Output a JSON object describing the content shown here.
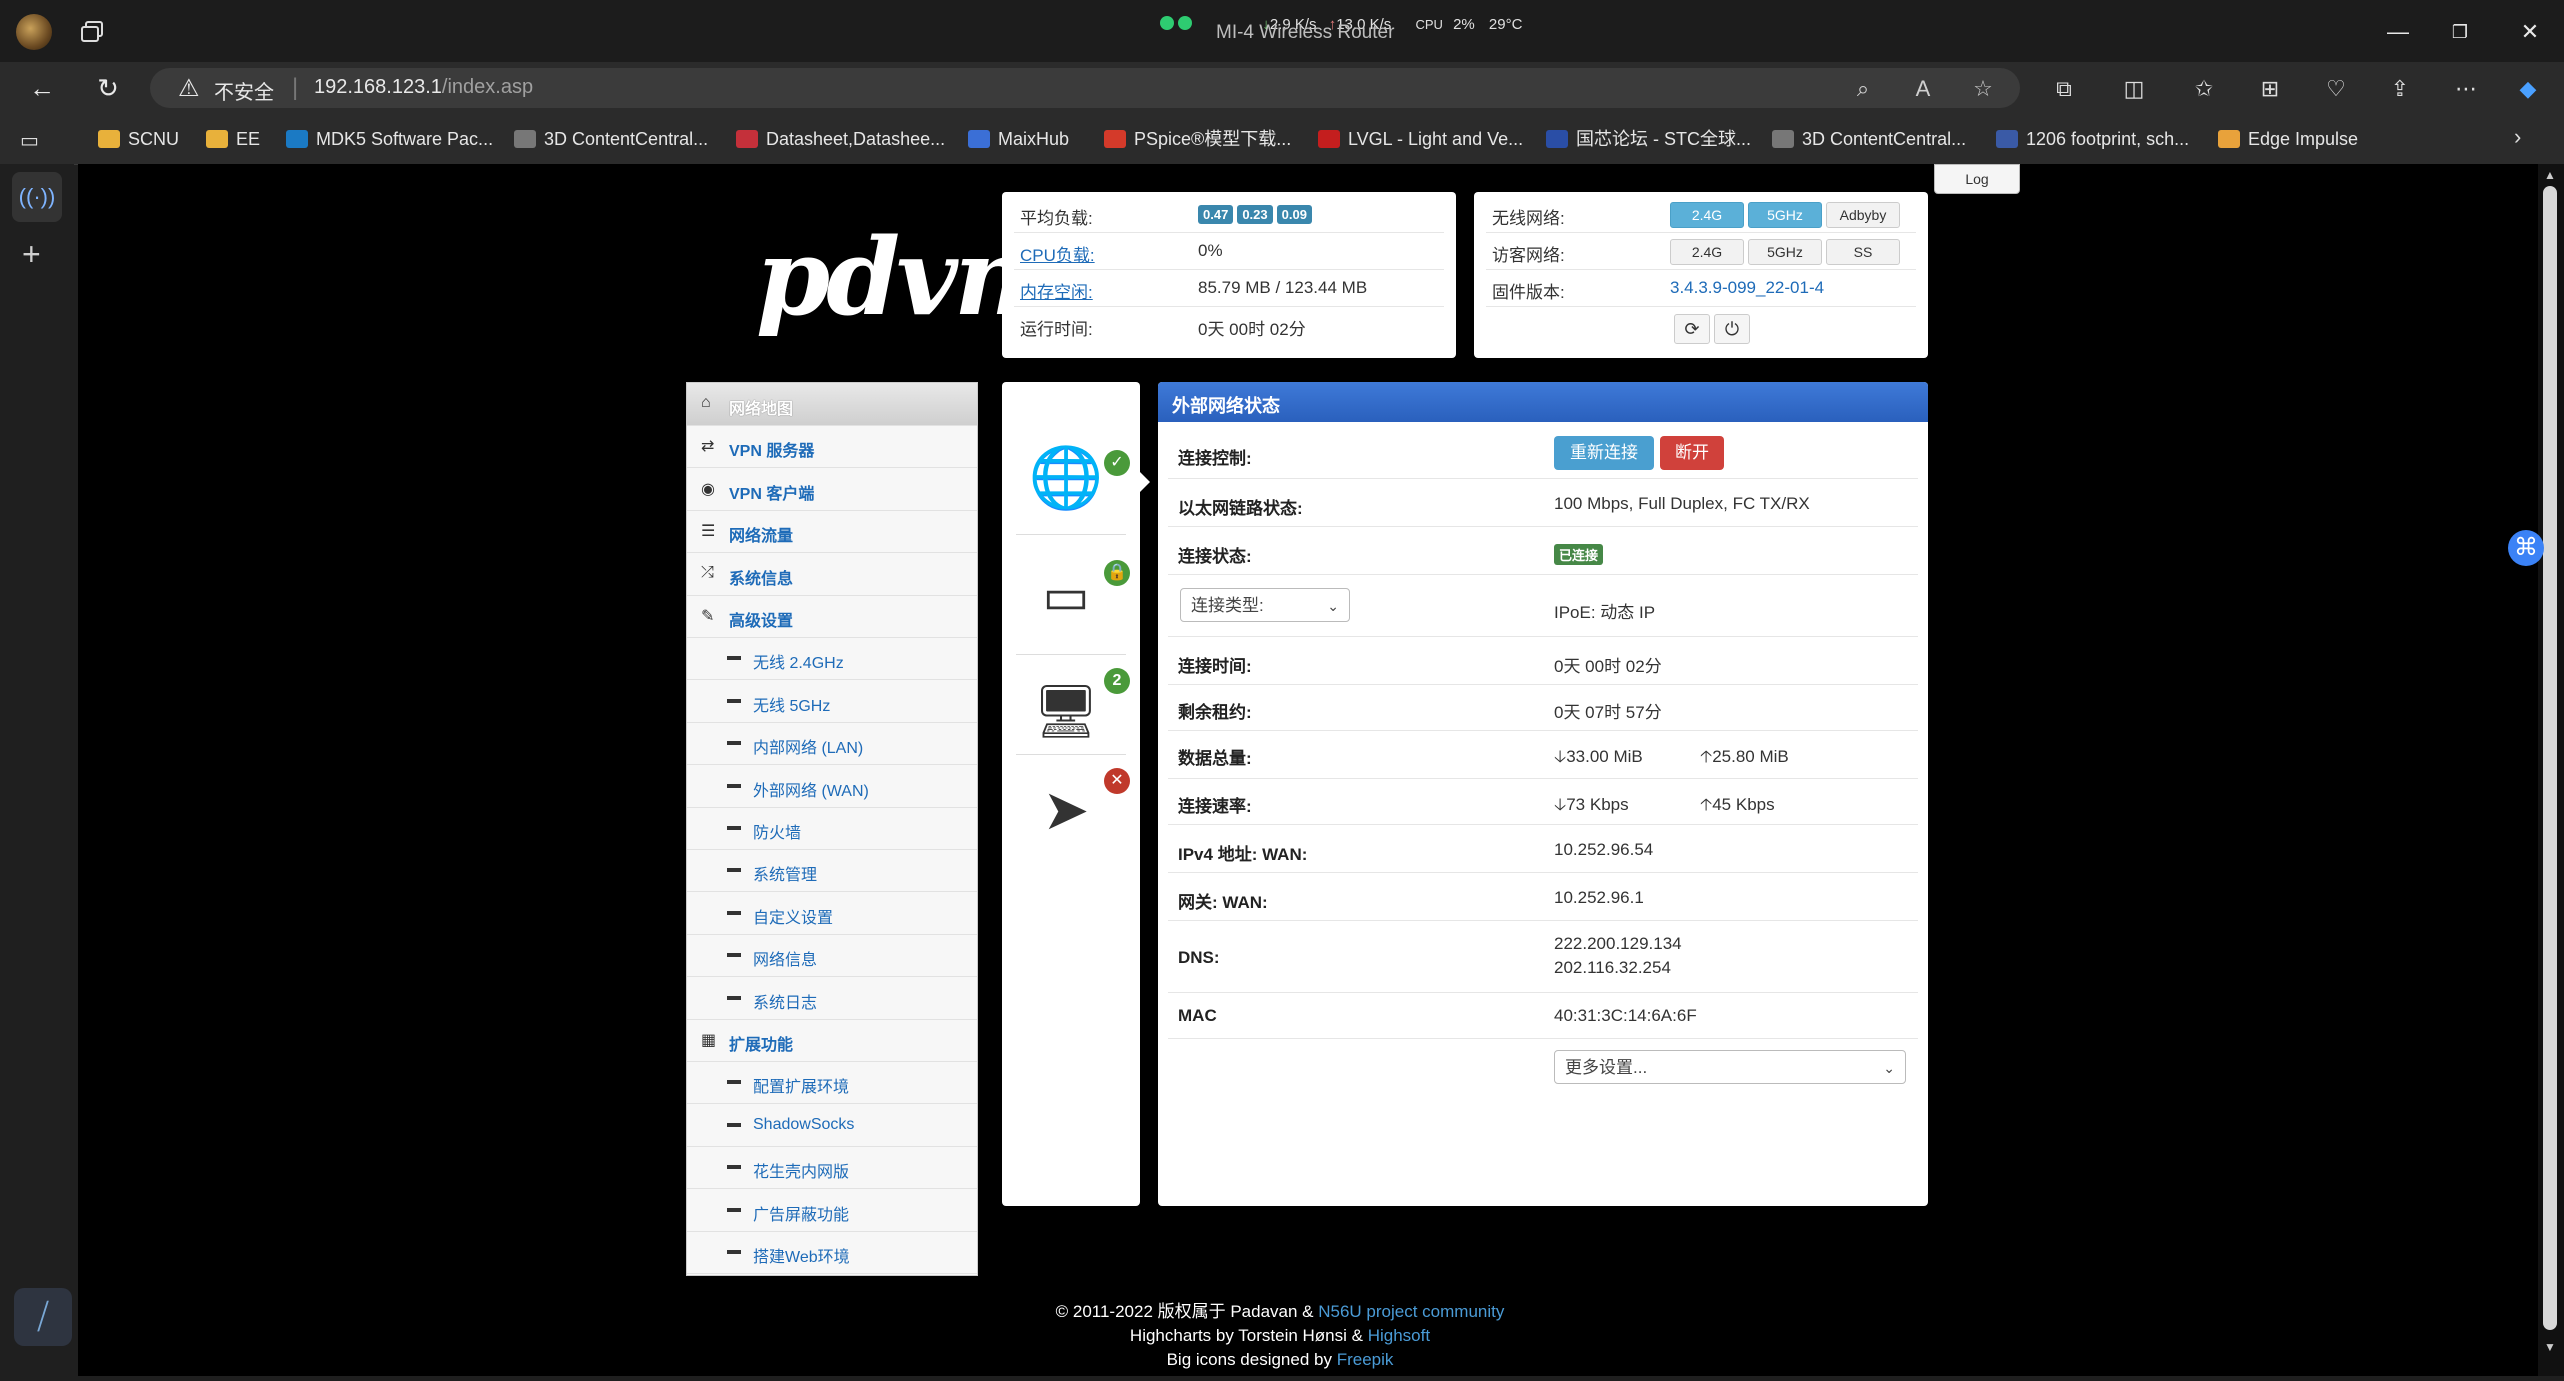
{
  "window": {
    "title": "MI-4 Wireless Router",
    "net_down": "2.9 K/s",
    "net_up": "13.0 K/s",
    "cpu_label": "CPU",
    "cpu_pct": "2%",
    "temp": "29°C",
    "minimize": "—",
    "restore": "❐",
    "close": "✕"
  },
  "address_bar": {
    "insecure_label": "不安全",
    "url_host": "192.168.123.1",
    "url_path": "/index.asp"
  },
  "bookmarks": [
    {
      "label": "SCNU",
      "color": "#e8b13b"
    },
    {
      "label": "EE",
      "color": "#e8b13b"
    },
    {
      "label": "MDK5 Software Pac...",
      "color": "#1b7ac4"
    },
    {
      "label": "3D ContentCentral...",
      "color": "#777777"
    },
    {
      "label": "Datasheet,Datashee...",
      "color": "#c4303a"
    },
    {
      "label": "MaixHub",
      "color": "#3b6fd6"
    },
    {
      "label": "PSpice®模型下载...",
      "color": "#d43a2a"
    },
    {
      "label": "LVGL - Light and Ve...",
      "color": "#c41e1e"
    },
    {
      "label": "国芯论坛 - STC全球...",
      "color": "#2a4ea6"
    },
    {
      "label": "3D ContentCentral...",
      "color": "#777777"
    },
    {
      "label": "1206 footprint, sch...",
      "color": "#3a5aa6"
    },
    {
      "label": "Edge Impulse",
      "color": "#e8a23b"
    }
  ],
  "router": {
    "logo": "pdvn",
    "log_button": "Log",
    "stats": {
      "load_label": "平均负载:",
      "load": [
        "0.47",
        "0.23",
        "0.09"
      ],
      "cpu_label": "CPU负载:",
      "cpu": "0%",
      "mem_label": "内存空闲:",
      "mem": "85.79 MB / 123.44 MB",
      "uptime_label": "运行时间:",
      "uptime": "0天 00时 02分"
    },
    "wifi": {
      "wireless_label": "无线网络:",
      "guest_label": "访客网络:",
      "fw_label": "固件版本:",
      "fw": "3.4.3.9-099_22-01-4",
      "b24": "2.4G",
      "b5": "5GHz",
      "adbyby": "Adbyby",
      "ss": "SS"
    },
    "menu": [
      {
        "label": "网络地图",
        "icon": "⌂"
      },
      {
        "label": "VPN 服务器",
        "icon": "⇄"
      },
      {
        "label": "VPN 客户端",
        "icon": "◉"
      },
      {
        "label": "网络流量",
        "icon": "☰"
      },
      {
        "label": "系统信息",
        "icon": "⤮"
      },
      {
        "label": "高级设置",
        "icon": "✎"
      },
      {
        "label": "无线 2.4GHz"
      },
      {
        "label": "无线 5GHz"
      },
      {
        "label": "内部网络 (LAN)"
      },
      {
        "label": "外部网络 (WAN)"
      },
      {
        "label": "防火墙"
      },
      {
        "label": "系统管理"
      },
      {
        "label": "自定义设置"
      },
      {
        "label": "网络信息"
      },
      {
        "label": "系统日志"
      },
      {
        "label": "扩展功能",
        "icon": "▦"
      },
      {
        "label": "配置扩展环境"
      },
      {
        "label": "ShadowSocks"
      },
      {
        "label": "花生壳内网版"
      },
      {
        "label": "广告屏蔽功能"
      },
      {
        "label": "搭建Web环境"
      }
    ],
    "client_count": "2",
    "wan": {
      "title": "外部网络状态",
      "ctrl_label": "连接控制:",
      "reconnect": "重新连接",
      "disconnect": "断开",
      "link_label": "以太网链路状态:",
      "link": "100 Mbps, Full Duplex, FC TX/RX",
      "state_label": "连接状态:",
      "state": "已连接",
      "type_select": "连接类型:",
      "type": "IPoE: 动态 IP",
      "time_label": "连接时间:",
      "time": "0天 00时 02分",
      "lease_label": "剩余租约:",
      "lease": "0天 07时 57分",
      "total_label": "数据总量:",
      "total_down": "33.00 MiB",
      "total_up": "25.80 MiB",
      "rate_label": "连接速率:",
      "rate_down": "73 Kbps",
      "rate_up": "45 Kbps",
      "ipv4_label": "IPv4 地址: WAN:",
      "ipv4": "10.252.96.54",
      "gw_label": "网关: WAN:",
      "gw": "10.252.96.1",
      "dns_label": "DNS:",
      "dns1": "222.200.129.134",
      "dns2": "202.116.32.254",
      "mac_label": "MAC",
      "mac": "40:31:3C:14:6A:6F",
      "more": "更多设置..."
    },
    "footer": {
      "l1a": "© 2011-2022 版权属于 Padavan & ",
      "l1b": "N56U project community",
      "l2a": "Highcharts by Torstein Hønsi & ",
      "l2b": "Highsoft",
      "l3a": "Big icons designed by ",
      "l3b": "Freepik"
    }
  }
}
